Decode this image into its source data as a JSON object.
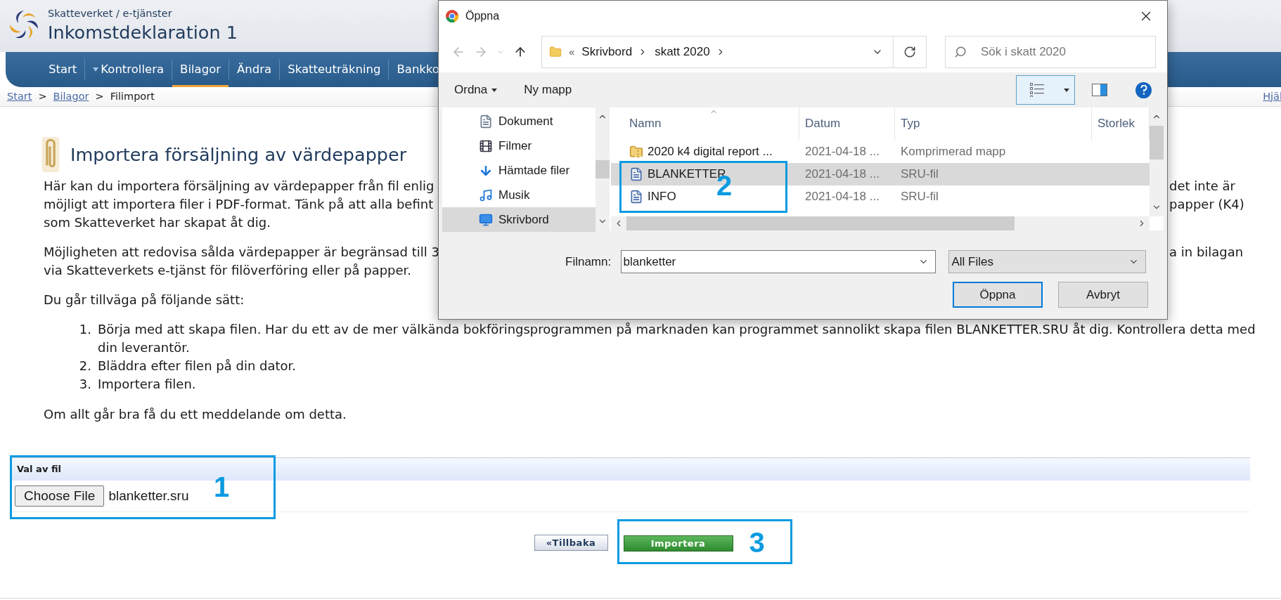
{
  "header": {
    "service": "Skatteverket / e-tjänster",
    "title": "Inkomstdeklaration 1"
  },
  "nav": [
    {
      "label": "Start",
      "selected": false,
      "dropdown": false
    },
    {
      "label": "Kontrollera",
      "selected": false,
      "dropdown": true
    },
    {
      "label": "Bilagor",
      "selected": true,
      "dropdown": false
    },
    {
      "label": "Ändra",
      "selected": false,
      "dropdown": false
    },
    {
      "label": "Skatteuträkning",
      "selected": false,
      "dropdown": false
    },
    {
      "label": "Bankko",
      "selected": false,
      "dropdown": false
    }
  ],
  "breadcrumb": [
    {
      "label": "Start",
      "kind": "link"
    },
    {
      "label": ">",
      "kind": "separator"
    },
    {
      "label": "Bilagor",
      "kind": "link"
    },
    {
      "label": ">",
      "kind": "separator"
    },
    {
      "label": "Filimport",
      "kind": "current"
    }
  ],
  "help_link": "Hjäl",
  "heading": "Importera försäljning av värdepapper",
  "paragraphs": [
    {
      "lines": [
        {
          "left": "Här kan du importera försäljning av värdepapper från fil enlig",
          "right": "det inte är"
        },
        {
          "left": "möjligt att importera filer i PDF-format. Tänk på att alla befint",
          "right": "papper (K4)"
        },
        {
          "left": "som Skatteverket har skapat åt dig."
        }
      ]
    },
    {
      "lines": [
        {
          "left": "Möjligheten att redovisa sålda värdepapper är begränsad till 3",
          "right": "a in bilagan"
        },
        {
          "left": "via Skatteverkets e-tjänst för filöverföring eller på papper."
        }
      ]
    },
    {
      "lines": [
        {
          "left": "Du går tillväga på följande sätt:"
        }
      ]
    }
  ],
  "steps": [
    {
      "number": "1.",
      "text": "Börja med att skapa filen. Har du ett av de mer välkända bokföringsprogrammen på marknaden kan programmet sannolikt skapa filen BLANKETTER.SRU åt dig. Kontrollera detta med din leverantör."
    },
    {
      "number": "2.",
      "text": "Bläddra efter filen på din dator."
    },
    {
      "number": "3.",
      "text": "Importera filen."
    }
  ],
  "closing": "Om allt går bra få du ett meddelande om detta.",
  "file_section": {
    "title": "Val av fil",
    "button": "Choose File",
    "file_name": "blanketter.sru",
    "annotation": "1"
  },
  "buttons": [
    {
      "label": "«Tillbaka",
      "kind": "secondary"
    },
    {
      "label": "Importera",
      "kind": "primary",
      "annotation": "3"
    }
  ],
  "dialog": {
    "title": "Öppna",
    "path": {
      "overflow": "«",
      "folders": [
        "Skrivbord",
        "skatt 2020"
      ]
    },
    "search_placeholder": "Sök i skatt 2020",
    "toolbar": [
      "Ordna",
      "Ny mapp"
    ],
    "nav_pane": [
      {
        "label": "Dokument",
        "kind": "document",
        "selected": false
      },
      {
        "label": "Filmer",
        "kind": "video",
        "selected": false
      },
      {
        "label": "Hämtade filer",
        "kind": "download",
        "selected": false
      },
      {
        "label": "Musik",
        "kind": "music",
        "selected": false
      },
      {
        "label": "Skrivbord",
        "kind": "desktop",
        "selected": true
      }
    ],
    "columns": [
      "Namn",
      "Datum",
      "Typ",
      "Storlek"
    ],
    "files": [
      {
        "name": "2020 k4 digital report ...",
        "date": "2021-04-18 ...",
        "type": "Komprimerad mapp",
        "kind": "zip",
        "selected": false
      },
      {
        "name": "BLANKETTER",
        "date": "2021-04-18 ...",
        "type": "SRU-fil",
        "kind": "document",
        "selected": true
      },
      {
        "name": "INFO",
        "date": "2021-04-18 ...",
        "type": "SRU-fil",
        "kind": "document",
        "selected": false
      }
    ],
    "files_annotation": "2",
    "filename_label": "Filnamn:",
    "filename": "blanketter",
    "filter": "All Files",
    "buttons": [
      "Öppna",
      "Avbryt"
    ]
  }
}
